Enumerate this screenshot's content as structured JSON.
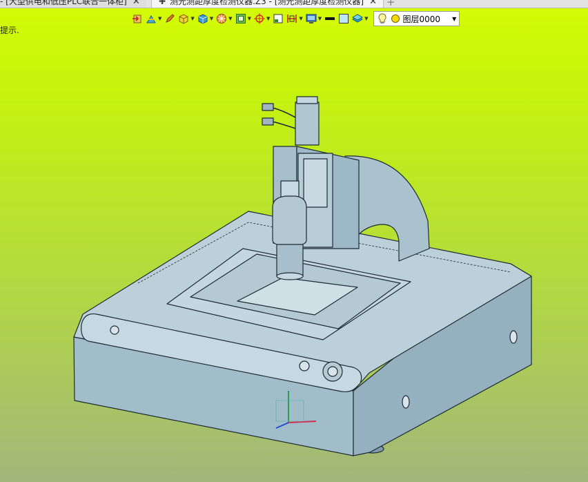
{
  "tabs": [
    {
      "label": "- [大型供电和低压PLC联合一体柜]",
      "close": "✕"
    },
    {
      "label": "测光测距厚度检测仪器.Z3 - [测光测距厚度检测仪器]",
      "close": "✕",
      "pin": "✚"
    }
  ],
  "new_tab": "+",
  "hint_text": "提示.",
  "toolbar": {
    "layer_name": "图层0000",
    "icons": [
      "exit-sketch-icon",
      "construction-icon",
      "pencil-icon",
      "box-shade-icon",
      "solid-view-icon",
      "cube-view-icon",
      "section-icon",
      "frame-icon",
      "snap-target-icon",
      "single-view-icon",
      "split-view-icon",
      "display-settings-icon",
      "line-style-icon",
      "color-fill-icon",
      "layer-stack-icon",
      "bulb-icon",
      "layer-color-dot"
    ]
  },
  "colors": {
    "viewport_top": "#d5fb06",
    "viewport_bottom": "#a2b67c",
    "model_body": "#a4bfcc",
    "model_top": "#bfd2dc",
    "model_edge": "#1c2a33"
  }
}
